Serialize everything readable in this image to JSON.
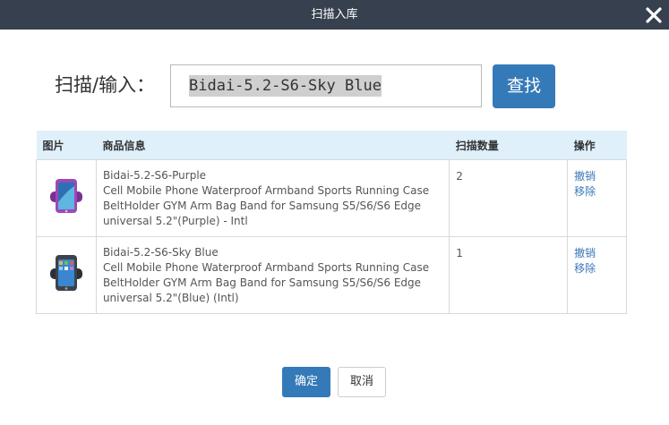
{
  "dialog": {
    "title": "扫描入库",
    "close_icon": "close-icon"
  },
  "scan": {
    "label": "扫描/输入：",
    "input_value": "Bidai-5.2-S6-Sky Blue",
    "search_label": "查找"
  },
  "table": {
    "headers": [
      "图片",
      "商品信息",
      "扫描数量",
      "操作"
    ],
    "rows": [
      {
        "image_icon": "purple-armband-product-image",
        "sku": "Bidai-5.2-S6-Purple",
        "desc_line1": "Cell Mobile Phone Waterproof Armband Sports Running Case",
        "desc_line2": "BeltHolder GYM Arm Bag Band for Samsung S5/S6/S6 Edge",
        "desc_line3": "universal 5.2\"(Purple) - Intl",
        "quantity": "2",
        "undo_label": "撤销",
        "remove_label": "移除",
        "accent": "#8a3fa8"
      },
      {
        "image_icon": "black-armband-product-image",
        "sku": "Bidai-5.2-S6-Sky Blue",
        "desc_line1": "Cell Mobile Phone Waterproof Armband Sports Running Case",
        "desc_line2": "BeltHolder GYM Arm Bag Band for Samsung S5/S6/S6 Edge",
        "desc_line3": "universal 5.2\"(Blue) (Intl)",
        "quantity": "1",
        "undo_label": "撤销",
        "remove_label": "移除",
        "accent": "#3a3f47"
      }
    ]
  },
  "footer": {
    "ok_label": "确定",
    "cancel_label": "取消"
  },
  "colors": {
    "titlebar": "#36404e",
    "primary": "#357ab8",
    "header_bg": "#dff0fb",
    "link": "#3a78b8"
  }
}
